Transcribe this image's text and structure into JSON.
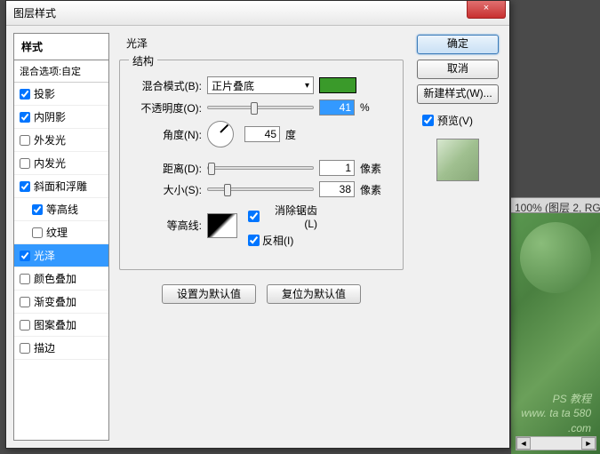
{
  "bg": {
    "tab_text": "100% (图层 2, RG",
    "watermark1": "PS 教程",
    "watermark2": "www. ta ta 580 .com"
  },
  "dialog": {
    "title": "图层样式",
    "close": "×"
  },
  "left": {
    "header": "样式",
    "blend_options": "混合选项:自定",
    "items": [
      {
        "label": "投影",
        "checked": true,
        "indent": false,
        "sel": false
      },
      {
        "label": "内阴影",
        "checked": true,
        "indent": false,
        "sel": false
      },
      {
        "label": "外发光",
        "checked": false,
        "indent": false,
        "sel": false
      },
      {
        "label": "内发光",
        "checked": false,
        "indent": false,
        "sel": false
      },
      {
        "label": "斜面和浮雕",
        "checked": true,
        "indent": false,
        "sel": false
      },
      {
        "label": "等高线",
        "checked": true,
        "indent": true,
        "sel": false
      },
      {
        "label": "纹理",
        "checked": false,
        "indent": true,
        "sel": false
      },
      {
        "label": "光泽",
        "checked": true,
        "indent": false,
        "sel": true
      },
      {
        "label": "颜色叠加",
        "checked": false,
        "indent": false,
        "sel": false
      },
      {
        "label": "渐变叠加",
        "checked": false,
        "indent": false,
        "sel": false
      },
      {
        "label": "图案叠加",
        "checked": false,
        "indent": false,
        "sel": false
      },
      {
        "label": "描边",
        "checked": false,
        "indent": false,
        "sel": false
      }
    ]
  },
  "mid": {
    "section_title": "光泽",
    "group_title": "结构",
    "blend_mode_label": "混合模式(B):",
    "blend_mode_value": "正片叠底",
    "opacity_label": "不透明度(O):",
    "opacity_value": "41",
    "opacity_unit": "%",
    "angle_label": "角度(N):",
    "angle_value": "45",
    "angle_unit": "度",
    "distance_label": "距离(D):",
    "distance_value": "1",
    "distance_unit": "像素",
    "size_label": "大小(S):",
    "size_value": "38",
    "size_unit": "像素",
    "contour_label": "等高线:",
    "antialias_label": "消除锯齿(L)",
    "invert_label": "反相(I)",
    "reset_default": "设置为默认值",
    "restore_default": "复位为默认值"
  },
  "right": {
    "ok": "确定",
    "cancel": "取消",
    "new_style": "新建样式(W)...",
    "preview_label": "预览(V)"
  },
  "colors": {
    "swatch": "#3a9a2a"
  }
}
